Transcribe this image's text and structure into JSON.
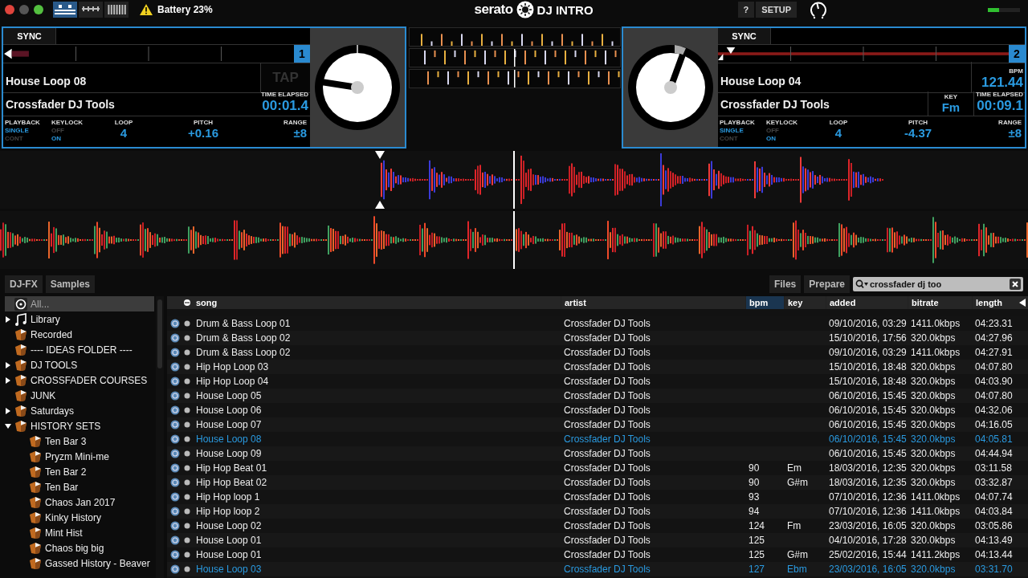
{
  "top_bar": {
    "view_buttons": [
      {
        "selected": true
      },
      {
        "selected": false
      },
      {
        "selected": false
      }
    ],
    "battery": "Battery 23%",
    "logo": "serato",
    "product": "DJ INTRO",
    "help": "?",
    "setup": "SETUP",
    "output_meter": {
      "level": 0.35
    }
  },
  "decks": [
    {
      "sync": "SYNC",
      "number": "1",
      "title": "House Loop 08",
      "artist": "Crossfader DJ Tools",
      "tap": "TAP",
      "time_label": "TIME ELAPSED",
      "time": "00:01.4",
      "playback": {
        "label": "PLAYBACK",
        "options": [
          {
            "label": "SINGLE",
            "selected": true
          },
          {
            "label": "CONT",
            "selected": false
          }
        ]
      },
      "keylock": {
        "label": "KEYLOCK",
        "options": [
          {
            "label": "OFF",
            "selected": false
          },
          {
            "label": "ON",
            "selected": true
          }
        ]
      },
      "loop": {
        "label": "LOOP",
        "value": "4"
      },
      "pitch": {
        "label": "PITCH",
        "value": "+0.16"
      },
      "range": {
        "label": "RANGE",
        "value": "±8"
      }
    },
    {
      "sync": "SYNC",
      "number": "2",
      "title": "House Loop 04",
      "artist": "Crossfader DJ Tools",
      "bpm": {
        "label": "BPM",
        "value": "121.44"
      },
      "key": {
        "label": "KEY",
        "value": "Fm"
      },
      "time_label": "TIME ELAPSED",
      "time": "00:09.1",
      "playback": {
        "label": "PLAYBACK",
        "options": [
          {
            "label": "SINGLE",
            "selected": true
          },
          {
            "label": "CONT",
            "selected": false
          }
        ]
      },
      "keylock": {
        "label": "KEYLOCK",
        "options": [
          {
            "label": "OFF",
            "selected": false
          },
          {
            "label": "ON",
            "selected": true
          }
        ]
      },
      "loop": {
        "label": "LOOP",
        "value": "4"
      },
      "pitch": {
        "label": "PITCH",
        "value": "-4.37"
      },
      "range": {
        "label": "RANGE",
        "value": "±8"
      }
    }
  ],
  "library": {
    "tabs": [
      {
        "label": "DJ-FX",
        "selected": false
      },
      {
        "label": "Samples",
        "selected": false
      }
    ],
    "buttons": [
      {
        "label": "Files"
      },
      {
        "label": "Prepare"
      }
    ],
    "search": {
      "value": "crossfader dj too"
    },
    "sidebar": [
      {
        "label": "All...",
        "kind": "all",
        "selected": true
      },
      {
        "label": "Library",
        "kind": "library",
        "selected": false,
        "expanded": false
      },
      {
        "label": "Recorded",
        "kind": "crate",
        "selected": false
      },
      {
        "label": "---- IDEAS FOLDER ----",
        "kind": "crate",
        "selected": false
      },
      {
        "label": "DJ TOOLS",
        "kind": "crate",
        "selected": false,
        "expanded": false
      },
      {
        "label": "CROSSFADER COURSES",
        "kind": "crate",
        "selected": false,
        "expanded": false
      },
      {
        "label": "JUNK",
        "kind": "crate",
        "selected": false
      },
      {
        "label": "Saturdays",
        "kind": "crate",
        "selected": false,
        "expanded": false
      },
      {
        "label": "HISTORY SETS",
        "kind": "crate",
        "selected": false,
        "expanded": true,
        "children": [
          {
            "label": "Ten Bar 3",
            "kind": "crate",
            "selected": false
          },
          {
            "label": "Pryzm Mini-me",
            "kind": "crate",
            "selected": false
          },
          {
            "label": "Ten Bar 2",
            "kind": "crate",
            "selected": false
          },
          {
            "label": "Ten Bar",
            "kind": "crate",
            "selected": false
          },
          {
            "label": "Chaos Jan 2017",
            "kind": "crate",
            "selected": false
          },
          {
            "label": "Kinky History",
            "kind": "crate",
            "selected": false
          },
          {
            "label": "Mint Hist",
            "kind": "crate",
            "selected": false
          },
          {
            "label": "Chaos big big",
            "kind": "crate",
            "selected": false
          },
          {
            "label": "Gassed History - Beaver",
            "kind": "crate",
            "selected": false
          }
        ]
      }
    ],
    "columns": [
      {
        "label": "song",
        "sorted": false
      },
      {
        "label": "artist",
        "sorted": false
      },
      {
        "label": "bpm",
        "sorted": true
      },
      {
        "label": "key",
        "sorted": false
      },
      {
        "label": "added",
        "sorted": false
      },
      {
        "label": "bitrate",
        "sorted": false
      },
      {
        "label": "length",
        "sorted": false
      }
    ],
    "rows": [
      {
        "song": "Drum & Bass Loop 01",
        "artist": "Crossfader DJ Tools",
        "bpm": "",
        "key": "",
        "added": "09/10/2016, 03:29",
        "bitrate": "1411.0kbps",
        "length": "04:23.31",
        "loaded": false
      },
      {
        "song": "Drum & Bass Loop 02",
        "artist": "Crossfader DJ Tools",
        "bpm": "",
        "key": "",
        "added": "15/10/2016, 17:56",
        "bitrate": "320.0kbps",
        "length": "04:27.96",
        "loaded": false
      },
      {
        "song": "Drum & Bass Loop 02",
        "artist": "Crossfader DJ Tools",
        "bpm": "",
        "key": "",
        "added": "09/10/2016, 03:29",
        "bitrate": "1411.0kbps",
        "length": "04:27.91",
        "loaded": false
      },
      {
        "song": "Hip Hop Loop 03",
        "artist": "Crossfader DJ Tools",
        "bpm": "",
        "key": "",
        "added": "15/10/2016, 18:48",
        "bitrate": "320.0kbps",
        "length": "04:07.80",
        "loaded": false
      },
      {
        "song": "Hip Hop Loop 04",
        "artist": "Crossfader DJ Tools",
        "bpm": "",
        "key": "",
        "added": "15/10/2016, 18:48",
        "bitrate": "320.0kbps",
        "length": "04:03.90",
        "loaded": false
      },
      {
        "song": "House Loop 05",
        "artist": "Crossfader DJ Tools",
        "bpm": "",
        "key": "",
        "added": "06/10/2016, 15:45",
        "bitrate": "320.0kbps",
        "length": "04:07.80",
        "loaded": false
      },
      {
        "song": "House Loop 06",
        "artist": "Crossfader DJ Tools",
        "bpm": "",
        "key": "",
        "added": "06/10/2016, 15:45",
        "bitrate": "320.0kbps",
        "length": "04:32.06",
        "loaded": false
      },
      {
        "song": "House Loop 07",
        "artist": "Crossfader DJ Tools",
        "bpm": "",
        "key": "",
        "added": "06/10/2016, 15:45",
        "bitrate": "320.0kbps",
        "length": "04:16.05",
        "loaded": false
      },
      {
        "song": "House Loop 08",
        "artist": "Crossfader DJ Tools",
        "bpm": "",
        "key": "",
        "added": "06/10/2016, 15:45",
        "bitrate": "320.0kbps",
        "length": "04:05.81",
        "loaded": true
      },
      {
        "song": "House Loop 09",
        "artist": "Crossfader DJ Tools",
        "bpm": "",
        "key": "",
        "added": "06/10/2016, 15:45",
        "bitrate": "320.0kbps",
        "length": "04:44.94",
        "loaded": false
      },
      {
        "song": "Hip Hop Beat 01",
        "artist": "Crossfader DJ Tools",
        "bpm": "90",
        "key": "Em",
        "added": "18/03/2016, 12:35",
        "bitrate": "320.0kbps",
        "length": "03:11.58",
        "loaded": false
      },
      {
        "song": "Hip Hop Beat 02",
        "artist": "Crossfader DJ Tools",
        "bpm": "90",
        "key": "G#m",
        "added": "18/03/2016, 12:35",
        "bitrate": "320.0kbps",
        "length": "03:32.87",
        "loaded": false
      },
      {
        "song": "Hip Hop loop 1",
        "artist": "Crossfader DJ Tools",
        "bpm": "93",
        "key": "",
        "added": "07/10/2016, 12:36",
        "bitrate": "1411.0kbps",
        "length": "04:07.74",
        "loaded": false
      },
      {
        "song": "Hip Hop loop 2",
        "artist": "Crossfader DJ Tools",
        "bpm": "94",
        "key": "",
        "added": "07/10/2016, 12:36",
        "bitrate": "1411.0kbps",
        "length": "04:03.84",
        "loaded": false
      },
      {
        "song": "House Loop 02",
        "artist": "Crossfader DJ Tools",
        "bpm": "124",
        "key": "Fm",
        "added": "23/03/2016, 16:05",
        "bitrate": "320.0kbps",
        "length": "03:05.86",
        "loaded": false
      },
      {
        "song": "House Loop 01",
        "artist": "Crossfader DJ Tools",
        "bpm": "125",
        "key": "",
        "added": "04/10/2016, 17:28",
        "bitrate": "320.0kbps",
        "length": "04:13.49",
        "loaded": false
      },
      {
        "song": "House Loop 01",
        "artist": "Crossfader DJ Tools",
        "bpm": "125",
        "key": "G#m",
        "added": "25/02/2016, 15:44",
        "bitrate": "1411.2kbps",
        "length": "04:13.44",
        "loaded": false
      },
      {
        "song": "House Loop 03",
        "artist": "Crossfader DJ Tools",
        "bpm": "127",
        "key": "Ebm",
        "added": "23/03/2016, 16:05",
        "bitrate": "320.0kbps",
        "length": "03:31.70",
        "loaded": true
      }
    ]
  }
}
